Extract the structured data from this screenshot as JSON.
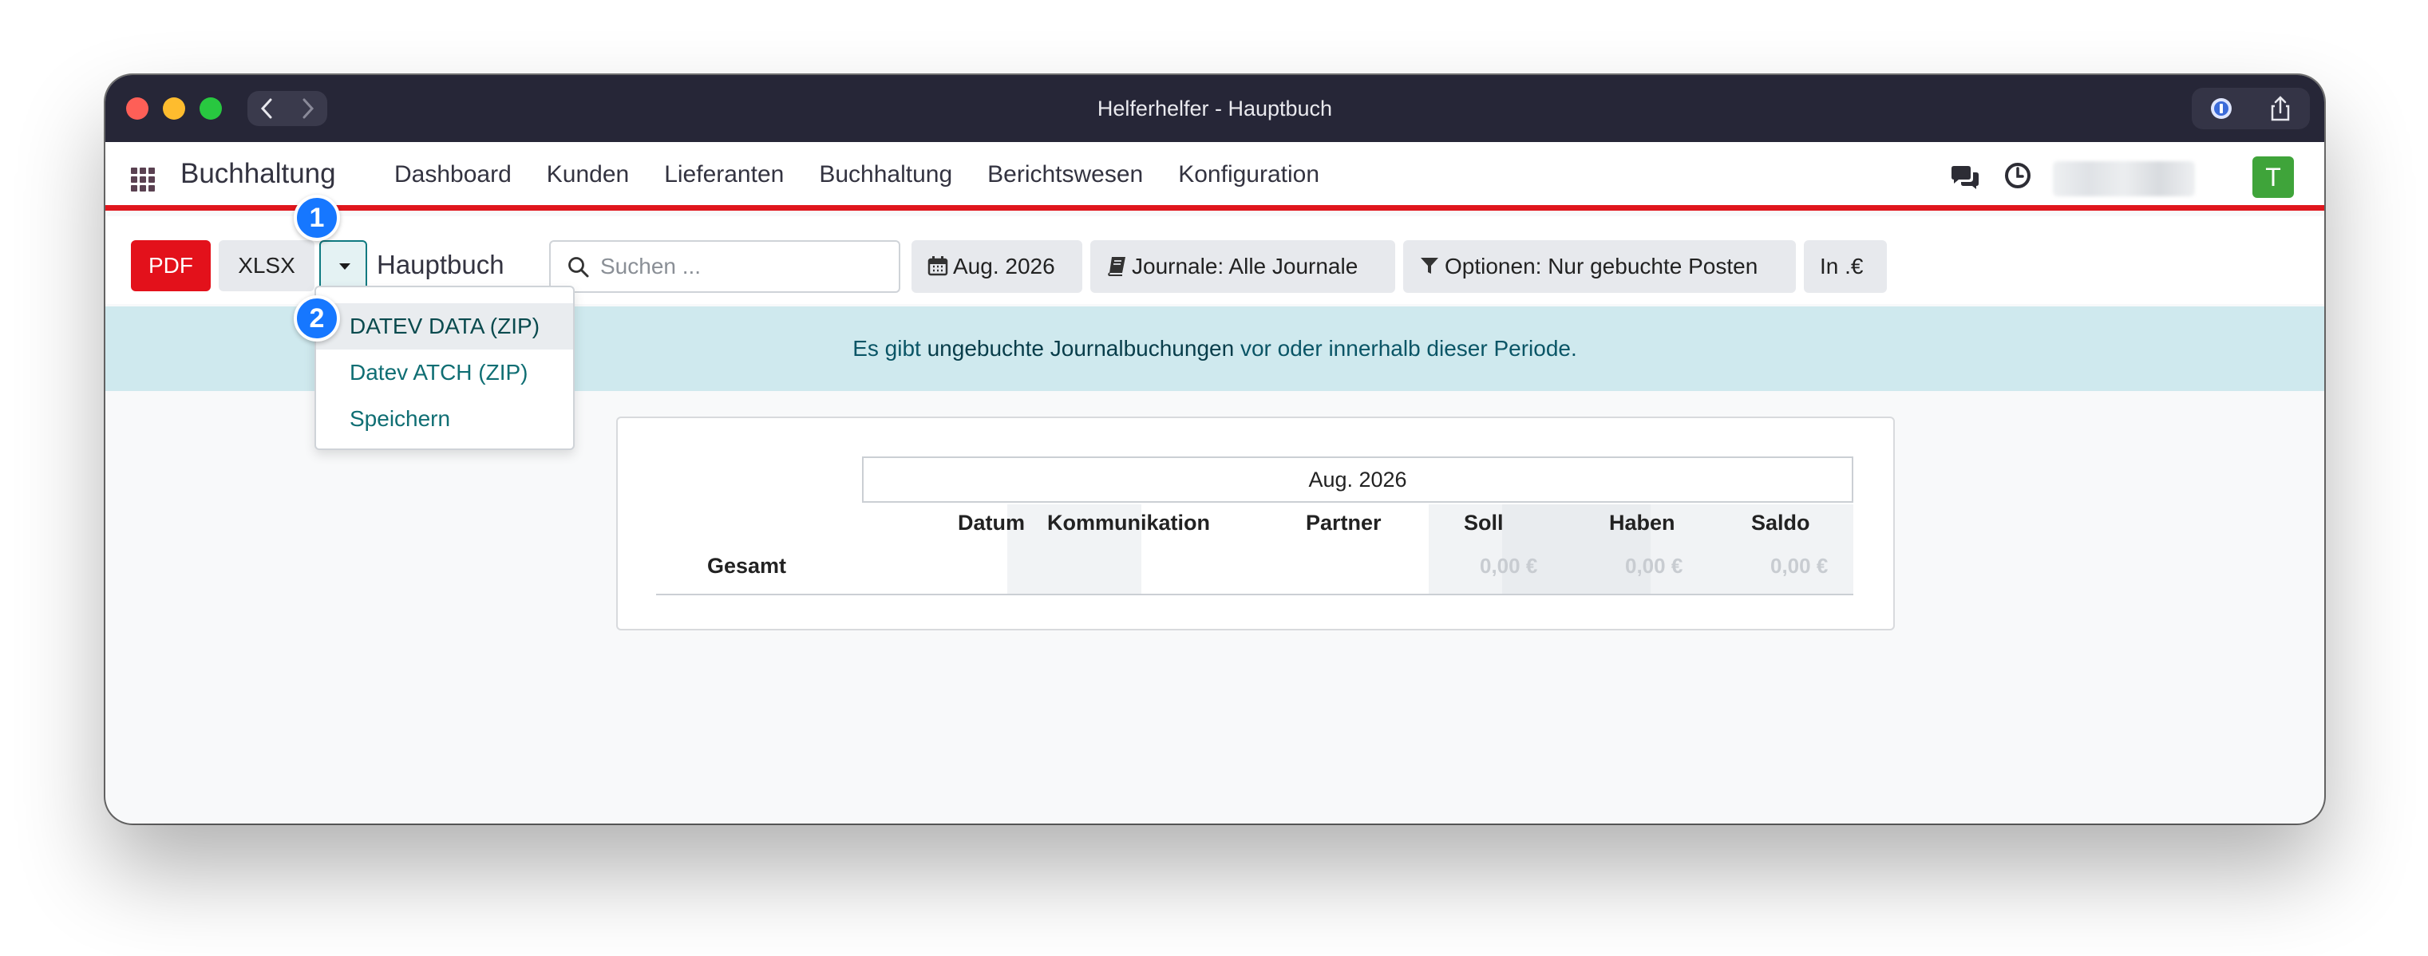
{
  "window": {
    "title": "Helferhelfer - Hauptbuch"
  },
  "navbar": {
    "brand": "Buchhaltung",
    "menu": [
      "Dashboard",
      "Kunden",
      "Lieferanten",
      "Buchhaltung",
      "Berichtswesen",
      "Konfiguration"
    ],
    "avatar_initial": "T"
  },
  "toolbar": {
    "pdf_label": "PDF",
    "xlsx_label": "XLSX",
    "page_title": "Hauptbuch",
    "search_placeholder": "Suchen ...",
    "filters": {
      "date": "Aug. 2026",
      "journals": "Journale: Alle Journale",
      "options": "Optionen: Nur gebuchte Posten",
      "currency": "In .€"
    }
  },
  "dropdown": {
    "items": [
      "DATEV DATA (ZIP)",
      "Datev ATCH (ZIP)",
      "Speichern"
    ]
  },
  "alert": {
    "prefix": "Es gibt ",
    "highlight": "ungebuchte Journalbuchungen",
    "suffix": " vor oder innerhalb dieser Periode."
  },
  "report": {
    "period": "Aug. 2026",
    "columns": [
      "Datum",
      "Kommunikation",
      "Partner",
      "Soll",
      "Haben",
      "Saldo"
    ],
    "total_label": "Gesamt",
    "totals": {
      "soll": "0,00 €",
      "haben": "0,00 €",
      "saldo": "0,00 €"
    }
  },
  "annotations": {
    "badge_1": "1",
    "badge_2": "2"
  }
}
